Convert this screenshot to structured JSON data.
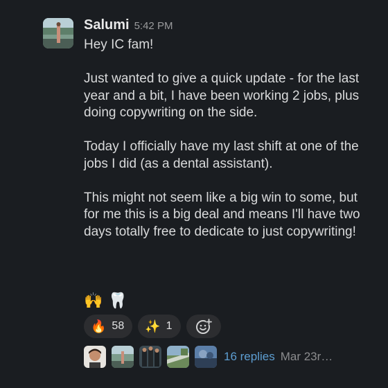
{
  "message": {
    "author": "Salumi",
    "time": "5:42 PM",
    "paragraphs": [
      "Hey IC fam!",
      "Just wanted to give a quick update - for the last year and a bit, I have been working 2 jobs, plus doing copywriting on the side.",
      "Today I officially have my last shift at one of the jobs I did (as a dental assistant).",
      "This might not seem like a big win to some, but for me this is a big deal and means I'll have two days totally free to dedicate to just copywriting!"
    ],
    "emoji_line": [
      "🙌",
      "🦷"
    ]
  },
  "reactions": [
    {
      "emoji": "🔥",
      "count": "58"
    },
    {
      "emoji": "✨",
      "count": "1"
    }
  ],
  "add_reaction": {
    "icon": "add-reaction-icon"
  },
  "thread": {
    "replies_label": "16 replies",
    "last_reply": "Mar 23r…",
    "participant_count": 5
  },
  "colors": {
    "background": "#1a1d21",
    "text": "#d9dadb",
    "link": "#5d9ed2",
    "muted": "#9a9b9d",
    "pill": "#2c2d30"
  }
}
